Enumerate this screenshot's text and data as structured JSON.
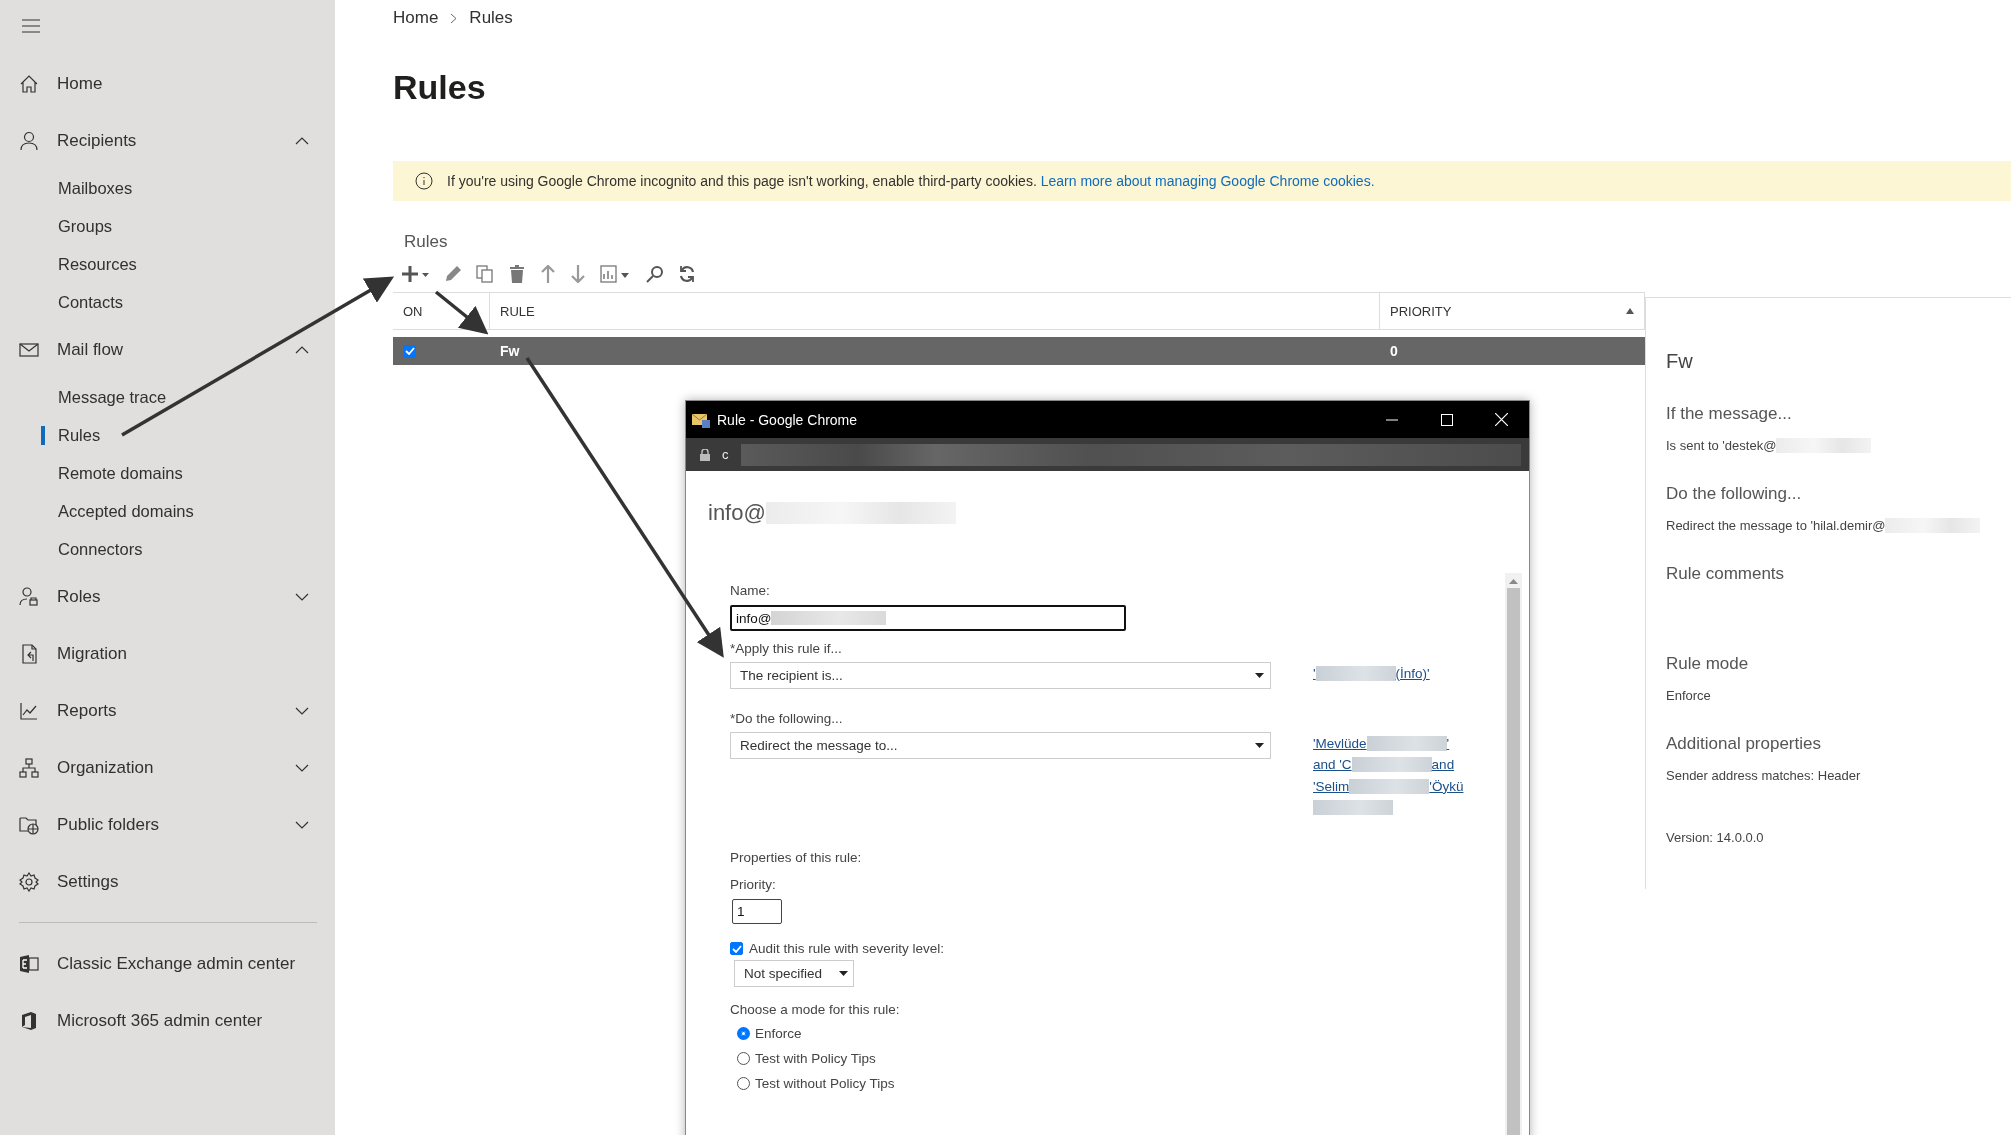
{
  "breadcrumb": [
    {
      "label": "Home"
    },
    {
      "label": "Rules"
    }
  ],
  "page_title": "Rules",
  "banner": {
    "text": "If you're using Google Chrome incognito and this page isn't working, enable third-party cookies.",
    "link": "Learn more about managing Google Chrome cookies."
  },
  "nav": [
    {
      "label": "Home"
    },
    {
      "label": "Recipients",
      "expanded": true,
      "children": [
        {
          "label": "Mailboxes",
          "selected": false
        },
        {
          "label": "Groups",
          "selected": false
        },
        {
          "label": "Resources",
          "selected": false
        },
        {
          "label": "Contacts",
          "selected": false
        }
      ]
    },
    {
      "label": "Mail flow",
      "expanded": true,
      "children": [
        {
          "label": "Message trace",
          "selected": false
        },
        {
          "label": "Rules",
          "selected": true
        },
        {
          "label": "Remote domains",
          "selected": false
        },
        {
          "label": "Accepted domains",
          "selected": false
        },
        {
          "label": "Connectors",
          "selected": false
        }
      ]
    },
    {
      "label": "Roles",
      "expanded": false
    },
    {
      "label": "Migration"
    },
    {
      "label": "Reports",
      "expanded": false
    },
    {
      "label": "Organization",
      "expanded": false
    },
    {
      "label": "Public folders",
      "expanded": false
    },
    {
      "label": "Settings"
    }
  ],
  "nav_links": [
    {
      "label": "Classic Exchange admin center"
    },
    {
      "label": "Microsoft 365 admin center"
    }
  ],
  "rules": {
    "label": "Rules",
    "columns": [
      {
        "label": "ON"
      },
      {
        "label": "RULE"
      },
      {
        "label": "PRIORITY",
        "sort_ascending": true
      }
    ],
    "rows": [
      {
        "on": true,
        "rule": "Fw",
        "priority": "0",
        "selected": true
      }
    ]
  },
  "details": {
    "title": "Fw",
    "sections": [
      {
        "heading": "If the message...",
        "text": "Is sent to 'destek@",
        "blurred": true
      },
      {
        "heading": "Do the following...",
        "text": "Redirect the message to 'hilal.demir@",
        "blurred": true
      },
      {
        "heading": "Rule comments"
      },
      {
        "heading": "Rule mode",
        "text": "Enforce"
      },
      {
        "heading": "Additional properties",
        "text": "Sender address matches: Header"
      }
    ],
    "version": "Version: 14.0.0.0"
  },
  "dialog": {
    "title": "Rule - Google Chrome",
    "address": "c",
    "address_blurred": true,
    "heading": "info@",
    "heading_blurred": true,
    "name_label": "Name:",
    "name_value": "info@",
    "name_blurred": true,
    "conditions": [
      {
        "label": "*Apply this rule if...",
        "value": "The recipient is...",
        "links": [
          [
            {
              "kind": "text",
              "text": "'"
            },
            {
              "kind": "blur"
            },
            {
              "kind": "text",
              "text": " (İnfo)'"
            }
          ]
        ]
      },
      {
        "label": "*Do the following...",
        "value": "Redirect the message to...",
        "links": [
          [
            {
              "kind": "text",
              "text": "'Mevlüde "
            },
            {
              "kind": "blur"
            },
            {
              "kind": "text",
              "text": "'"
            }
          ],
          [
            {
              "kind": "text",
              "text": "and 'C"
            },
            {
              "kind": "blur"
            },
            {
              "kind": "text",
              "text": "and"
            }
          ],
          [
            {
              "kind": "text",
              "text": "'Selim "
            },
            {
              "kind": "blur"
            },
            {
              "kind": "text",
              "text": "'Öykü"
            }
          ],
          [
            {
              "kind": "blur"
            }
          ]
        ]
      }
    ],
    "properties_label": "Properties of this rule:",
    "priority_label": "Priority:",
    "priority_value": "1",
    "audit": {
      "label": "Audit this rule with severity level:",
      "checked": true
    },
    "severity": "Not specified",
    "mode_label": "Choose a mode for this rule:",
    "modes": [
      {
        "label": "Enforce",
        "selected": true
      },
      {
        "label": "Test with Policy Tips",
        "selected": false
      },
      {
        "label": "Test without Policy Tips",
        "selected": false
      }
    ]
  }
}
